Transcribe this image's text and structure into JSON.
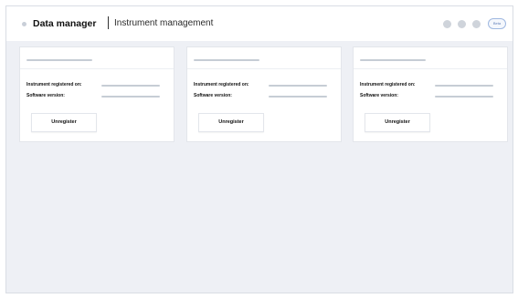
{
  "header": {
    "app_title": "Data manager",
    "section_title": "Instrument management",
    "pill_label": "Beta"
  },
  "cards": [
    {
      "registered_label": "Instrument registered on:",
      "software_label": "Software version:",
      "button_label": "Unregister"
    },
    {
      "registered_label": "Instrument registered on:",
      "software_label": "Software version:",
      "button_label": "Unregister"
    },
    {
      "registered_label": "Instrument registered on:",
      "software_label": "Software version:",
      "button_label": "Unregister"
    }
  ],
  "colors": {
    "page_background": "#ffffff",
    "content_background": "#eef0f5",
    "placeholder": "#c6cdd5",
    "text_primary": "#111111",
    "pill_border": "#9fb8e0"
  },
  "icons": {
    "header_left": "dot-icon",
    "header_right": [
      "status-dot-icon",
      "status-dot-icon",
      "status-dot-icon"
    ]
  }
}
